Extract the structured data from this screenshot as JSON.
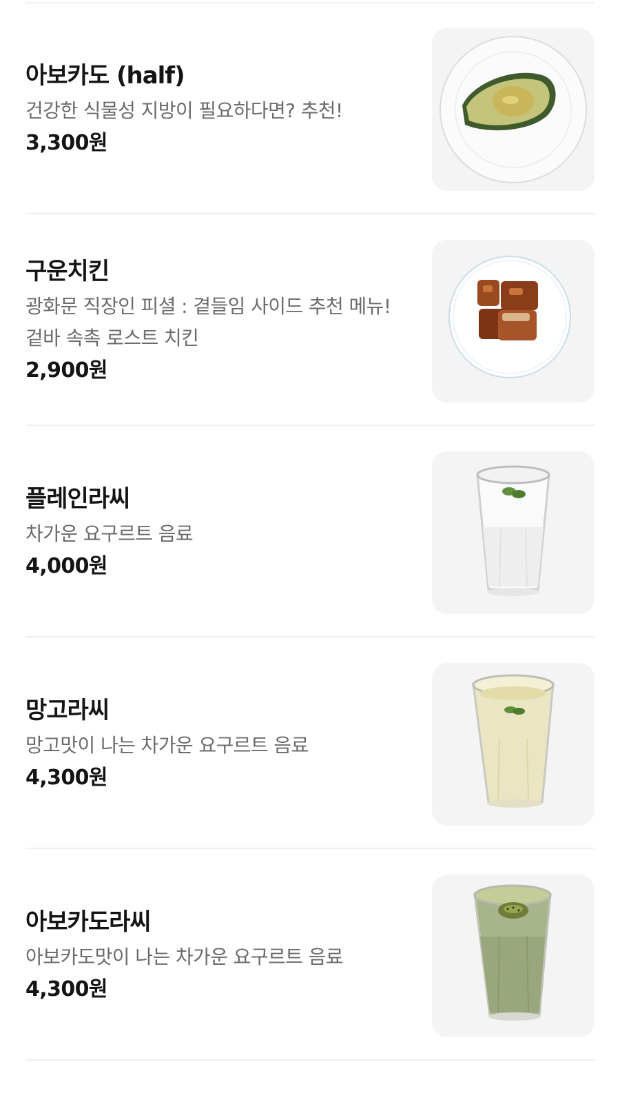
{
  "menu": {
    "items": [
      {
        "name": "아보카도 (half)",
        "description": "건강한 식물성 지방이 필요하다면? 추천!",
        "price": "3,300원",
        "image_icon": "avocado-plate-image"
      },
      {
        "name": "구운치킨",
        "description": "광화문 직장인 피셜 : 곁들임 사이드 추천 메뉴! 겉바 속촉 로스트 치킨",
        "price": "2,900원",
        "image_icon": "roast-chicken-plate-image"
      },
      {
        "name": "플레인라씨",
        "description": "차가운 요구르트 음료",
        "price": "4,000원",
        "image_icon": "plain-lassi-glass-image"
      },
      {
        "name": "망고라씨",
        "description": "망고맛이 나는 차가운 요구르트 음료",
        "price": "4,300원",
        "image_icon": "mango-lassi-glass-image"
      },
      {
        "name": "아보카도라씨",
        "description": "아보카도맛이 나는 차가운 요구르트 음료",
        "price": "4,300원",
        "image_icon": "avocado-lassi-glass-image"
      }
    ]
  },
  "colors": {
    "background": "#ffffff",
    "divider": "#efefef",
    "thumb_background": "#f4f4f4",
    "text_primary": "#141414",
    "text_secondary": "#6b6b6b"
  }
}
